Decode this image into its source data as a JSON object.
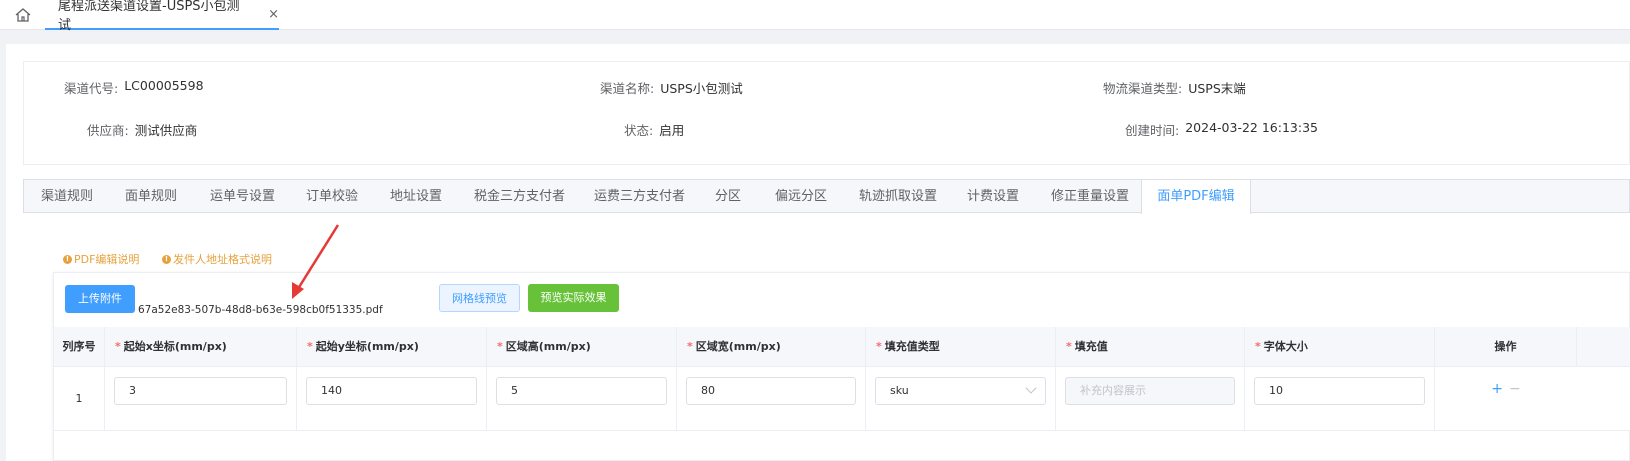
{
  "topbar": {
    "tab_title": "尾程派送渠道设置-USPS小包测试",
    "close": "×"
  },
  "info": [
    {
      "label": "渠道代号:",
      "value": "LC00005598"
    },
    {
      "label": "渠道名称:",
      "value": "USPS小包测试"
    },
    {
      "label": "物流渠道类型:",
      "value": "USPS末端"
    },
    {
      "label": "供应商:",
      "value": "测试供应商"
    },
    {
      "label": "状态:",
      "value": "启用"
    },
    {
      "label": "创建时间:",
      "value": "2024-03-22 16:13:35"
    }
  ],
  "tabs": [
    "渠道规则",
    "面单规则",
    "运单号设置",
    "订单校验",
    "地址设置",
    "税金三方支付者",
    "运费三方支付者",
    "分区",
    "偏远分区",
    "轨迹抓取设置",
    "计费设置",
    "修正重量设置",
    "面单PDF编辑"
  ],
  "active_tab": "面单PDF编辑",
  "help_links": [
    "PDF编辑说明",
    "发件人地址格式说明"
  ],
  "buttons": {
    "upload": "上传附件",
    "grid_preview": "网格线预览",
    "actual_preview": "预览实际效果"
  },
  "filename": "67a52e83-507b-48d8-b63e-598cb0f51335.pdf",
  "table": {
    "headers": [
      "列序号",
      "起始x坐标(mm/px)",
      "起始y坐标(mm/px)",
      "区域高(mm/px)",
      "区域宽(mm/px)",
      "填充值类型",
      "填充值",
      "字体大小",
      "操作"
    ],
    "rows": [
      {
        "index": "1",
        "x": "3",
        "y": "140",
        "height": "5",
        "width": "80",
        "fill_type": "sku",
        "fill_placeholder": "补充内容展示",
        "font_size": "10",
        "add": "+",
        "remove": "−"
      }
    ]
  },
  "colors": {
    "primary": "#409eff",
    "success": "#67c23a",
    "warning": "#e6a23c",
    "danger": "#f56c6c",
    "arrow": "#e53935"
  }
}
